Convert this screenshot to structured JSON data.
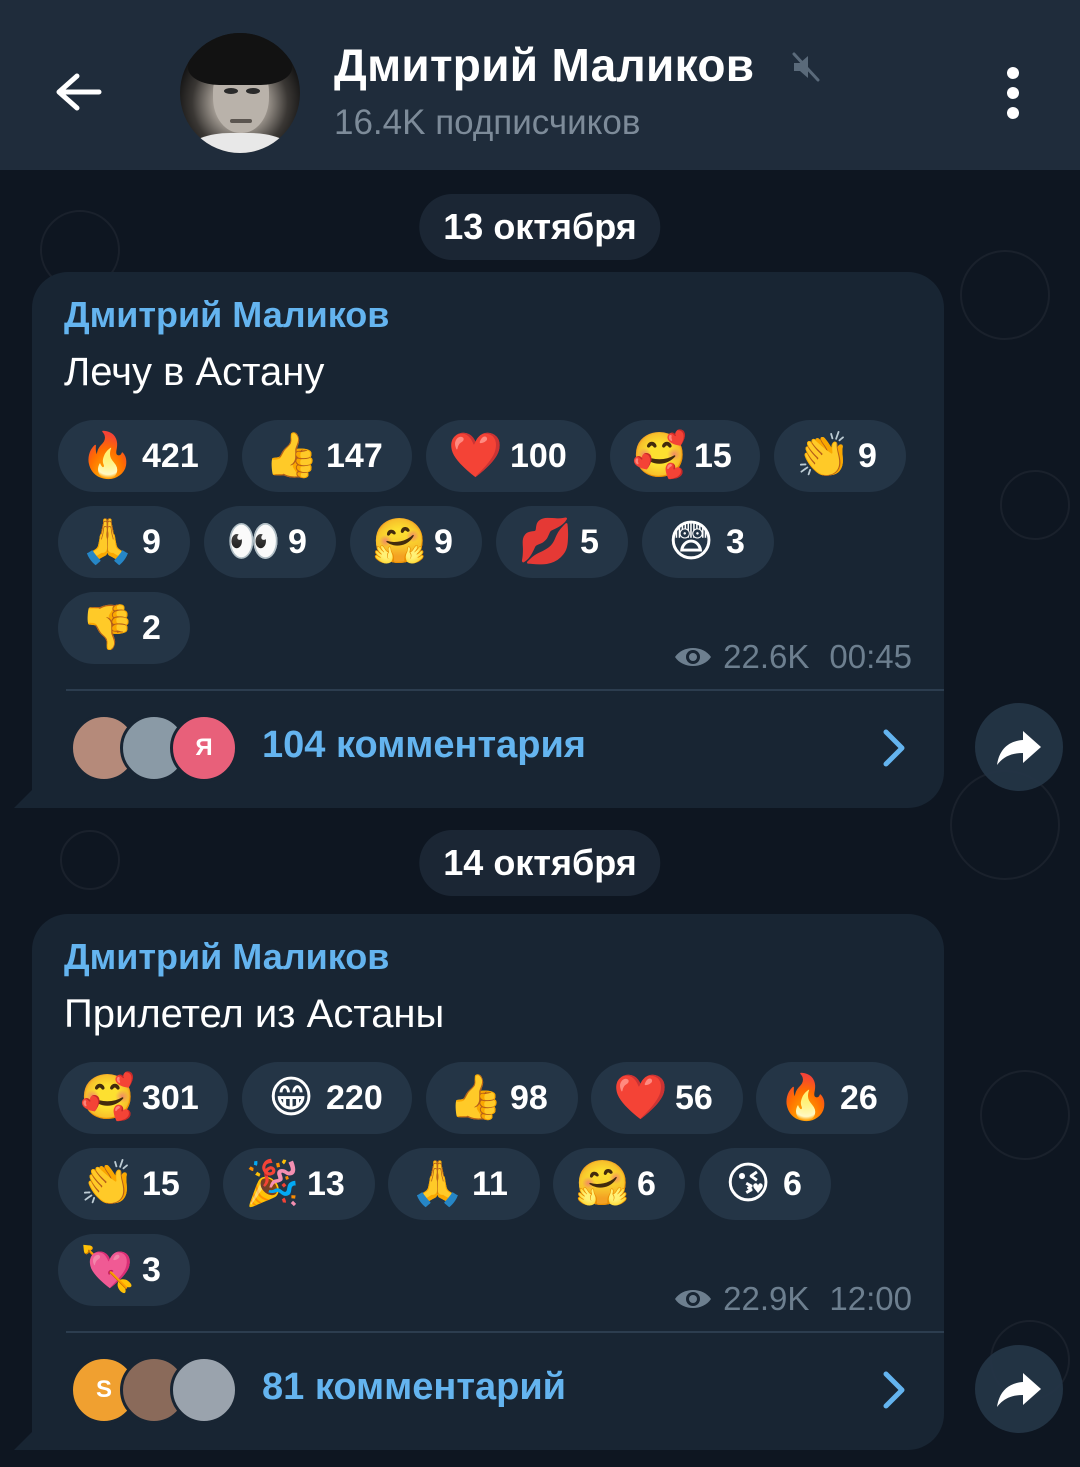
{
  "header": {
    "title": "Дмитрий Маликов",
    "subscribers": "16.4K подписчиков",
    "back_icon": "arrow-left-icon",
    "mute_icon": "mute-icon",
    "menu_icon": "kebab-menu-icon"
  },
  "messages": [
    {
      "date": "13 октября",
      "author": "Дмитрий Маликов",
      "text": "Лечу в Астану",
      "reactions": [
        {
          "emoji": "🔥",
          "count": "421"
        },
        {
          "emoji": "👍",
          "count": "147"
        },
        {
          "emoji": "❤️",
          "count": "100"
        },
        {
          "emoji": "🥰",
          "count": "15"
        },
        {
          "emoji": "👏",
          "count": "9"
        },
        {
          "emoji": "🙏",
          "count": "9"
        },
        {
          "emoji": "👀",
          "count": "9"
        },
        {
          "emoji": "🤗",
          "count": "9"
        },
        {
          "emoji": "💋",
          "count": "5"
        },
        {
          "emoji": "😨",
          "count": "3"
        },
        {
          "emoji": "👎",
          "count": "2"
        }
      ],
      "views": "22.6K",
      "time": "00:45",
      "comments_label": "104 комментария",
      "commenter_avatars": [
        {
          "initial": "",
          "color": "#b58a7a"
        },
        {
          "initial": "",
          "color": "#8a9aa6"
        },
        {
          "initial": "Я",
          "color": "#e8607a"
        }
      ]
    },
    {
      "date": "14 октября",
      "author": "Дмитрий Маликов",
      "text": "Прилетел из Астаны",
      "reactions": [
        {
          "emoji": "🥰",
          "count": "301"
        },
        {
          "emoji": "😁",
          "count": "220"
        },
        {
          "emoji": "👍",
          "count": "98"
        },
        {
          "emoji": "❤️",
          "count": "56"
        },
        {
          "emoji": "🔥",
          "count": "26"
        },
        {
          "emoji": "👏",
          "count": "15"
        },
        {
          "emoji": "🎉",
          "count": "13"
        },
        {
          "emoji": "🙏",
          "count": "11"
        },
        {
          "emoji": "🤗",
          "count": "6"
        },
        {
          "emoji": "😘",
          "count": "6"
        },
        {
          "emoji": "💘",
          "count": "3"
        }
      ],
      "views": "22.9K",
      "time": "12:00",
      "comments_label": "81 комментарий",
      "commenter_avatars": [
        {
          "initial": "S",
          "color": "#f0a030"
        },
        {
          "initial": "",
          "color": "#8a6a5a"
        },
        {
          "initial": "",
          "color": "#9aa3ad"
        }
      ]
    }
  ],
  "colors": {
    "background": "#0e1621",
    "header": "#1f2c3b",
    "bubble": "#182533",
    "accent": "#64b4ef",
    "reaction_pill": "#243546",
    "meta_text": "#6d7f8f"
  }
}
